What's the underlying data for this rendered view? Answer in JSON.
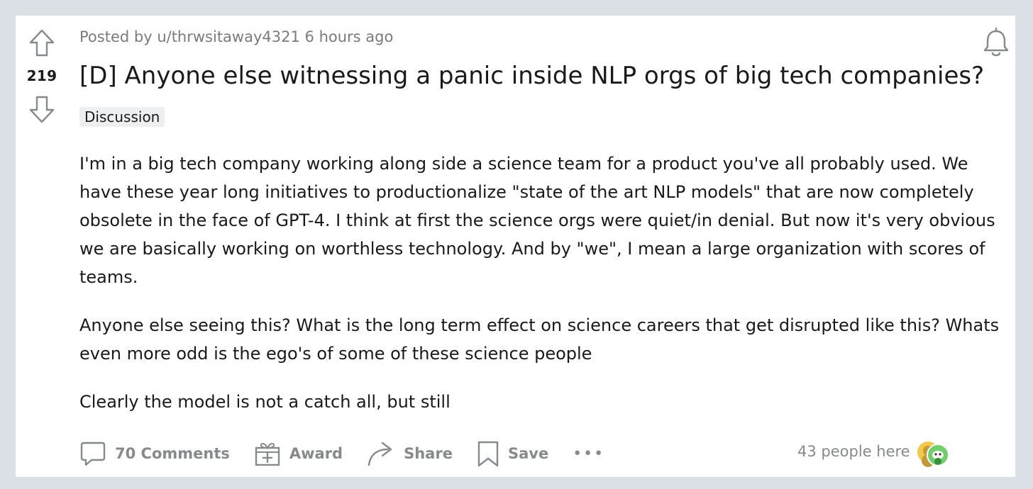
{
  "post": {
    "score": "219",
    "meta_prefix": "Posted by",
    "author": "u/thrwsitaway4321",
    "time": "6 hours ago",
    "title": "[D] Anyone else witnessing a panic inside NLP orgs of big tech companies?",
    "flair": "Discussion",
    "paragraphs": [
      "I'm in a big tech company working along side a science team for a product you've all probably used. We have these year long initiatives to productionalize \"state of the art NLP models\" that are now completely obsolete in the face of GPT-4. I think at first the science orgs were quiet/in denial. But now it's very obvious we are basically working on worthless technology. And by \"we\", I mean a large organization with scores of teams.",
      "Anyone else seeing this? What is the long term effect on science careers that get disrupted like this? Whats even more odd is the ego's of some of these science people",
      "Clearly the model is not a catch all, but still"
    ]
  },
  "actions": {
    "comments": "70 Comments",
    "award": "Award",
    "share": "Share",
    "save": "Save",
    "more": "•••"
  },
  "presence": {
    "text": "43 people here"
  },
  "icons": {
    "upvote": "arrow-up-outline-icon",
    "downvote": "arrow-down-outline-icon",
    "notify": "bell-icon",
    "comments": "comment-bubble-icon",
    "award": "gift-icon",
    "share": "share-arrow-icon",
    "save": "bookmark-icon"
  },
  "colors": {
    "page_bg": "#dae0e6",
    "card_bg": "#ffffff",
    "text": "#1a1a1b",
    "muted": "#878a8c",
    "flair_bg": "#edeff1"
  }
}
